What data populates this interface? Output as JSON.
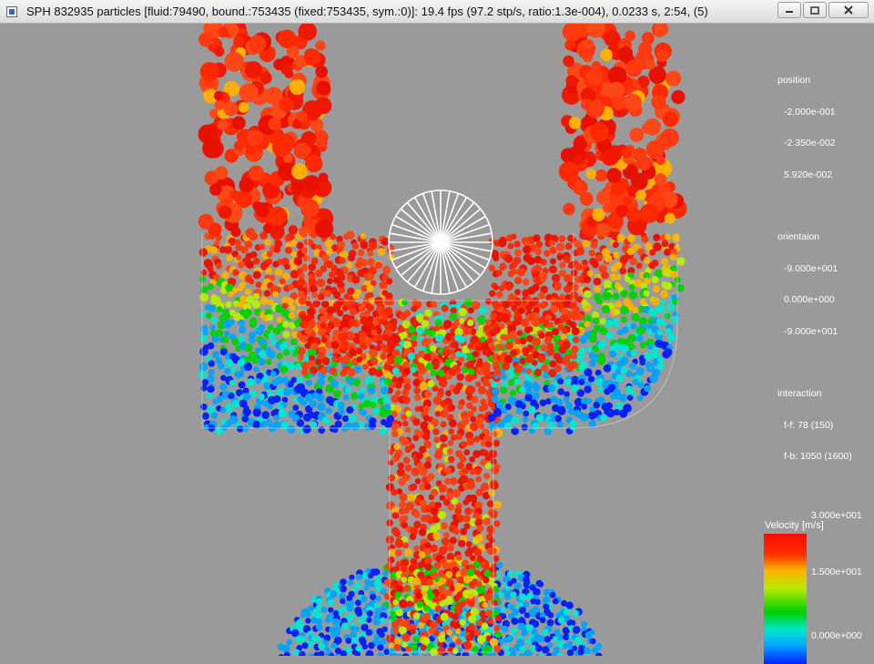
{
  "window": {
    "title": "SPH 832935 particles [fluid:79490, bound.:753435 (fixed:753435, sym.:0)]: 19.4 fps (97.2 stp/s, ratio:1.3e-004), 0.0233 s, 2:54, (5)",
    "minimize_icon": "minimize-icon",
    "maximize_icon": "maximize-icon",
    "close_icon": "close-icon"
  },
  "info_panel": {
    "position_label": "position",
    "position_values": [
      "-2.000e-001",
      "-2.350e-002",
      "5.920e-002"
    ],
    "orientation_label": "orientaion",
    "orientation_values": [
      "-9.000e+001",
      "0.000e+000",
      "-9.000e+001"
    ],
    "interaction_label": "interaction",
    "interaction_values": [
      "f-f: 78 (150)",
      "f-b: 1050 (1600)"
    ]
  },
  "legend": {
    "title": "Velocity [m/s]",
    "max_label": "3.000e+001",
    "mid_label": "1.500e+001",
    "min_label": "0.000e+000",
    "colors": [
      "#0021ff",
      "#00a4ff",
      "#00e5d0",
      "#00d000",
      "#b8ea00",
      "#ffb000",
      "#ff3000"
    ]
  },
  "scene": {
    "background": "#9a9a9a",
    "wheel_icon": "spoked-wheel-icon",
    "wheel_spokes": 36
  }
}
